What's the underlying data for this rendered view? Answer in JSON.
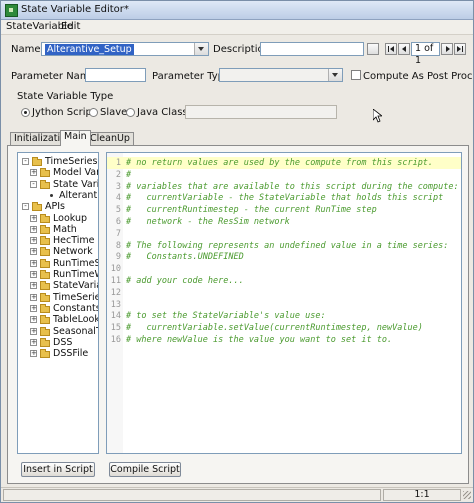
{
  "window": {
    "title": "State Variable Editor*"
  },
  "menu": [
    "StateVariable",
    "Edit"
  ],
  "form": {
    "name_label": "Name:",
    "name_value": "Alterantive_Setup",
    "description_label": "Description:",
    "description_value": "",
    "nav_counter": "1 of 1",
    "param_name_label": "Parameter Name:",
    "param_name_value": "",
    "param_type_label": "Parameter Type:",
    "param_type_value": "",
    "post_process_label": "Compute As Post Process",
    "post_process_checked": false
  },
  "variable_type": {
    "group_label": "State Variable Type",
    "options": [
      "Jython Script",
      "Slave",
      "Java Class"
    ],
    "selected": "Jython Script",
    "java_class_value": ""
  },
  "tabs": [
    "Initialization",
    "Main",
    "CleanUp"
  ],
  "active_tab": "Main",
  "tree": [
    {
      "label": "TimeSeries",
      "depth": 0,
      "toggle": "-",
      "icon": "folder-icon"
    },
    {
      "label": "Model Variab",
      "depth": 1,
      "toggle": "+",
      "icon": "folder-icon"
    },
    {
      "label": "State Variabl",
      "depth": 1,
      "toggle": "-",
      "icon": "folder-icon"
    },
    {
      "label": "Alterantiv",
      "depth": 2,
      "toggle": "",
      "icon": "leaf-icon"
    },
    {
      "label": "APIs",
      "depth": 0,
      "toggle": "-",
      "icon": "folder-icon"
    },
    {
      "label": "Lookup",
      "depth": 1,
      "toggle": "+",
      "icon": "folder-icon"
    },
    {
      "label": "Math",
      "depth": 1,
      "toggle": "+",
      "icon": "folder-icon"
    },
    {
      "label": "HecTime",
      "depth": 1,
      "toggle": "+",
      "icon": "folder-icon"
    },
    {
      "label": "Network",
      "depth": 1,
      "toggle": "+",
      "icon": "folder-icon"
    },
    {
      "label": "RunTimeSte",
      "depth": 1,
      "toggle": "+",
      "icon": "folder-icon"
    },
    {
      "label": "RunTimeWin",
      "depth": 1,
      "toggle": "+",
      "icon": "folder-icon"
    },
    {
      "label": "StateVariable",
      "depth": 1,
      "toggle": "+",
      "icon": "folder-icon"
    },
    {
      "label": "TimeSeries",
      "depth": 1,
      "toggle": "+",
      "icon": "folder-icon"
    },
    {
      "label": "Constants",
      "depth": 1,
      "toggle": "+",
      "icon": "folder-icon"
    },
    {
      "label": "TableLookup",
      "depth": 1,
      "toggle": "+",
      "icon": "folder-icon"
    },
    {
      "label": "SeasonalTal",
      "depth": 1,
      "toggle": "+",
      "icon": "folder-icon"
    },
    {
      "label": "DSS",
      "depth": 1,
      "toggle": "+",
      "icon": "folder-icon"
    },
    {
      "label": "DSSFile",
      "depth": 1,
      "toggle": "+",
      "icon": "folder-icon"
    }
  ],
  "code_lines": [
    {
      "n": "1",
      "text": "# no return values are used by the compute from this script."
    },
    {
      "n": "2",
      "text": "#"
    },
    {
      "n": "3",
      "text": "# variables that are available to this script during the compute:"
    },
    {
      "n": "4",
      "text": "#   currentVariable - the StateVariable that holds this script"
    },
    {
      "n": "5",
      "text": "#   currentRuntimestep - the current RunTime step"
    },
    {
      "n": "6",
      "text": "#   network - the ResSim network"
    },
    {
      "n": "7",
      "text": ""
    },
    {
      "n": "8",
      "text": "# The following represents an undefined value in a time series:"
    },
    {
      "n": "9",
      "text": "#   Constants.UNDEFINED"
    },
    {
      "n": "10",
      "text": ""
    },
    {
      "n": "11",
      "text": "# add your code here..."
    },
    {
      "n": "12",
      "text": ""
    },
    {
      "n": "13",
      "text": ""
    },
    {
      "n": "14",
      "text": "# to set the StateVariable's value use:"
    },
    {
      "n": "15",
      "text": "#   currentVariable.setValue(currentRuntimestep, newValue)"
    },
    {
      "n": "16",
      "text": "# where newValue is the value you want to set it to."
    }
  ],
  "buttons": {
    "insert": "Insert in Script",
    "compile": "Compile Script"
  },
  "status": {
    "position": "1:1"
  },
  "colors": {
    "comment": "#4a9a2e",
    "current_line": "#ffffc8",
    "selection": "#3163c5"
  }
}
